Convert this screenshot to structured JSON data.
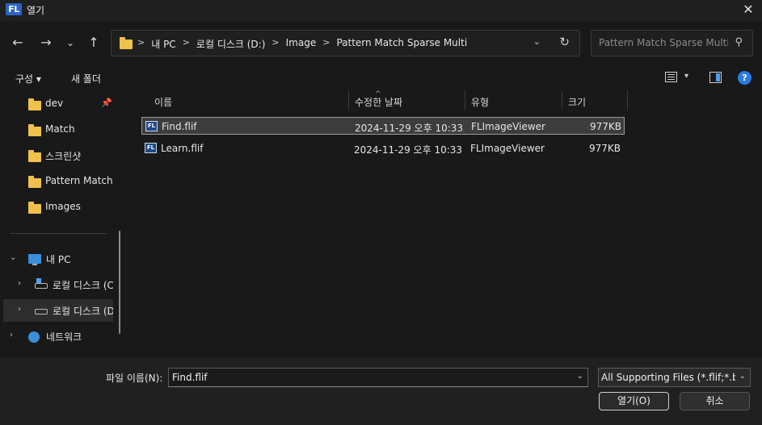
{
  "window": {
    "app_icon_text": "FL",
    "title": "열기"
  },
  "nav": {
    "breadcrumbs": [
      "내 PC",
      "로컬 디스크 (D:)",
      "Image",
      "Pattern Match Sparse Multi"
    ],
    "search_placeholder": "Pattern Match Sparse Multi..."
  },
  "toolbar": {
    "organize_label": "구성 ▾",
    "new_folder_label": "새 폴더",
    "help_label": "?"
  },
  "sidebar": {
    "quick": [
      {
        "label": "dev",
        "pinned": true
      },
      {
        "label": "Match"
      },
      {
        "label": "스크린샷"
      },
      {
        "label": "Pattern Match Sparse Multi"
      },
      {
        "label": "Images"
      }
    ],
    "tree": [
      {
        "label": "내 PC",
        "icon": "pc-icon",
        "expanded": true
      },
      {
        "label": "로컬 디스크 (C:)",
        "icon": "windows-drive-icon"
      },
      {
        "label": "로컬 디스크 (D:)",
        "icon": "drive-icon",
        "selected": true
      },
      {
        "label": "네트워크",
        "icon": "network-icon"
      }
    ]
  },
  "columns": {
    "name": "이름",
    "modified": "수정한 날짜",
    "type": "유형",
    "size": "크기"
  },
  "files": [
    {
      "name": "Find.flif",
      "modified": "2024-11-29 오후 10:33",
      "type": "FLImageViewer",
      "size": "977KB",
      "selected": true
    },
    {
      "name": "Learn.flif",
      "modified": "2024-11-29 오후 10:33",
      "type": "FLImageViewer",
      "size": "977KB",
      "selected": false
    }
  ],
  "footer": {
    "filename_label": "파일 이름(N):",
    "filename_value": "Find.flif",
    "filetype_value": "All Supporting Files (*.flif;*.bmp)",
    "open_label": "열기(O)",
    "cancel_label": "취소"
  }
}
